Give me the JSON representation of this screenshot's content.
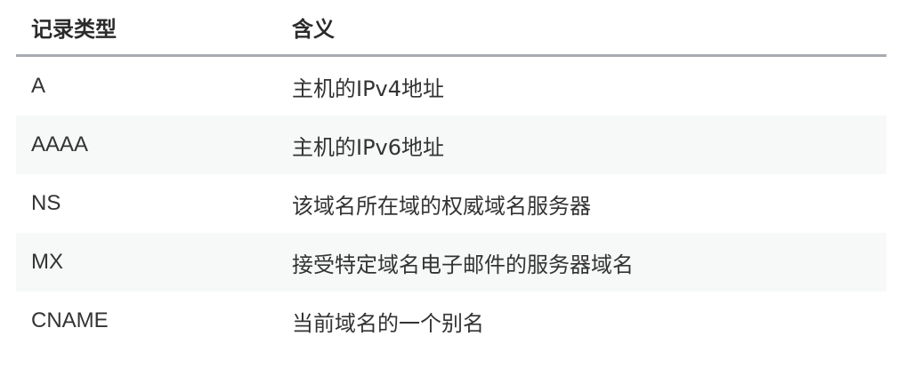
{
  "table": {
    "headers": {
      "type": "记录类型",
      "meaning": "含义"
    },
    "rows": [
      {
        "type": "A",
        "meaning": "主机的IPv4地址"
      },
      {
        "type": "AAAA",
        "meaning": "主机的IPv6地址"
      },
      {
        "type": "NS",
        "meaning": "该域名所在域的权威域名服务器"
      },
      {
        "type": "MX",
        "meaning": "接受特定域名电子邮件的服务器域名"
      },
      {
        "type": "CNAME",
        "meaning": "当前域名的一个别名"
      }
    ]
  },
  "colors": {
    "header_border": "#a7abb1",
    "alt_row_background": "#f7f8f8",
    "text": "#333333"
  }
}
